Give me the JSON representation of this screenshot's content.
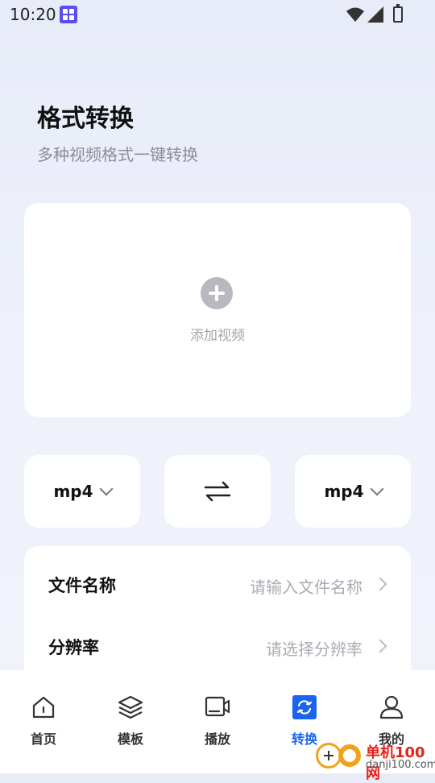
{
  "status": {
    "time": "10:20"
  },
  "header": {
    "title": "格式转换",
    "subtitle": "多种视频格式一键转换"
  },
  "add_card": {
    "label": "添加视频"
  },
  "formats": {
    "source": "mp4",
    "target": "mp4"
  },
  "settings": {
    "rows": [
      {
        "label": "文件名称",
        "value": "请输入文件名称"
      },
      {
        "label": "分辨率",
        "value": "请选择分辨率"
      }
    ]
  },
  "tabs": [
    {
      "label": "首页",
      "icon": "home-icon"
    },
    {
      "label": "模板",
      "icon": "layers-icon"
    },
    {
      "label": "播放",
      "icon": "video-camera-icon"
    },
    {
      "label": "转换",
      "icon": "convert-icon",
      "active": true
    },
    {
      "label": "我的",
      "icon": "user-icon"
    }
  ],
  "watermark": {
    "brand": "单机100网",
    "url": "danji100.com"
  },
  "colors": {
    "accent": "#1a64f0",
    "watermark_orange": "#f2a11b",
    "watermark_red": "#e2231a"
  }
}
